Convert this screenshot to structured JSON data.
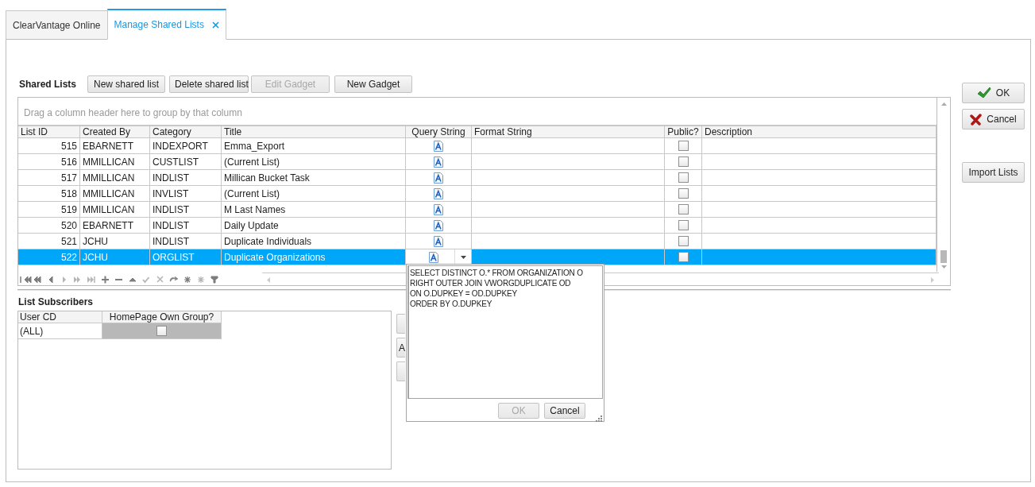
{
  "tabs": [
    {
      "label": "ClearVantage Online",
      "selected": false,
      "closable": false
    },
    {
      "label": "Manage Shared Lists",
      "selected": true,
      "closable": true
    }
  ],
  "shared_lists": {
    "title": "Shared Lists",
    "buttons": [
      {
        "label": "New shared list",
        "disabled": false
      },
      {
        "label": "Delete shared list",
        "disabled": false
      },
      {
        "label": "Edit Gadget",
        "disabled": true
      },
      {
        "label": "New Gadget",
        "disabled": false
      }
    ],
    "group_panel_hint": "Drag a column header here to group by that column",
    "columns": [
      "List ID",
      "Created By",
      "Category",
      "Title",
      "Query String",
      "Format String",
      "Public?",
      "Description"
    ],
    "rows": [
      {
        "list_id": "515",
        "created_by": "EBARNETT",
        "category": "INDEXPORT",
        "title": "Emma_Export",
        "public": false,
        "selected": false
      },
      {
        "list_id": "516",
        "created_by": "MMILLICAN",
        "category": "CUSTLIST",
        "title": "(Current List)",
        "public": false,
        "selected": false
      },
      {
        "list_id": "517",
        "created_by": "MMILLICAN",
        "category": "INDLIST",
        "title": "Millican Bucket Task",
        "public": false,
        "selected": false
      },
      {
        "list_id": "518",
        "created_by": "MMILLICAN",
        "category": "INVLIST",
        "title": "(Current List)",
        "public": false,
        "selected": false
      },
      {
        "list_id": "519",
        "created_by": "MMILLICAN",
        "category": "INDLIST",
        "title": "M Last Names",
        "public": false,
        "selected": false
      },
      {
        "list_id": "520",
        "created_by": "EBARNETT",
        "category": "INDLIST",
        "title": "Daily Update",
        "public": false,
        "selected": false
      },
      {
        "list_id": "521",
        "created_by": "JCHU",
        "category": "INDLIST",
        "title": "Duplicate Individuals",
        "public": false,
        "selected": false
      },
      {
        "list_id": "522",
        "created_by": "JCHU",
        "category": "ORGLIST",
        "title": "Duplicate Organizations",
        "public": false,
        "selected": true
      }
    ]
  },
  "list_subscribers": {
    "title": "List Subscribers",
    "columns": [
      "User CD",
      "HomePage Own Group?"
    ],
    "rows": [
      {
        "user_cd": "(ALL)",
        "homepage_own_group": false,
        "focused": true
      }
    ],
    "side_buttons": [
      {
        "kind": "blank"
      },
      {
        "kind": "text",
        "label": "A"
      },
      {
        "kind": "blank"
      }
    ]
  },
  "query_popup": {
    "text": "SELECT DISTINCT O.* FROM ORGANIZATION O\nRIGHT OUTER JOIN VWORGDUPLICATE OD\nON O.DUPKEY = OD.DUPKEY\nORDER BY O.DUPKEY",
    "buttons": [
      {
        "label": "OK",
        "disabled": true
      },
      {
        "label": "Cancel",
        "disabled": false
      }
    ]
  },
  "dialog_buttons": [
    {
      "label": "OK",
      "kind": "check"
    },
    {
      "label": "Cancel",
      "kind": "cross"
    },
    {
      "label": "Import Lists",
      "kind": "plain"
    }
  ]
}
